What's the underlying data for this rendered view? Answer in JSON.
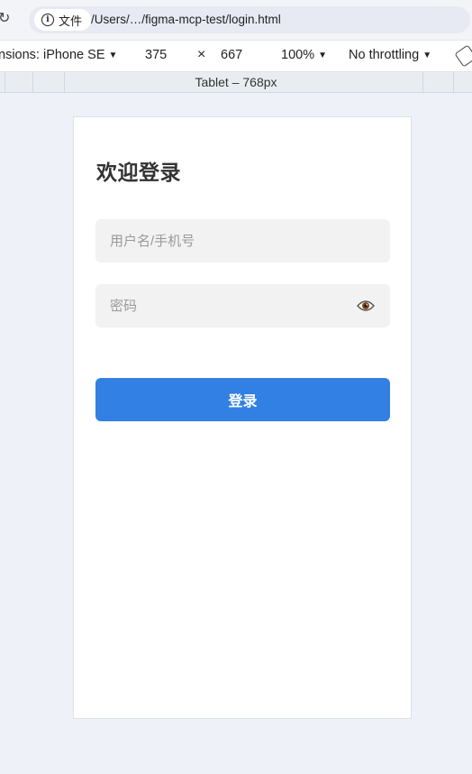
{
  "browser": {
    "info_label": "文件",
    "url": "/Users/…/figma-mcp-test/login.html"
  },
  "devtools": {
    "dimensions_label": "nsions: iPhone SE",
    "width": "375",
    "times": "×",
    "height": "667",
    "zoom": "100%",
    "throttling": "No throttling",
    "media_query_label": "Tablet – 768px"
  },
  "login": {
    "title": "欢迎登录",
    "username_placeholder": "用户名/手机号",
    "password_placeholder": "密码",
    "submit_label": "登录"
  },
  "colors": {
    "primary": "#3280e3",
    "input_bg": "#f2f2f2",
    "page_bg": "#eef1f8"
  },
  "icons": {
    "reload": "reload-icon",
    "info": "info-icon",
    "eye": "eye-icon",
    "rotate": "rotate-icon"
  }
}
